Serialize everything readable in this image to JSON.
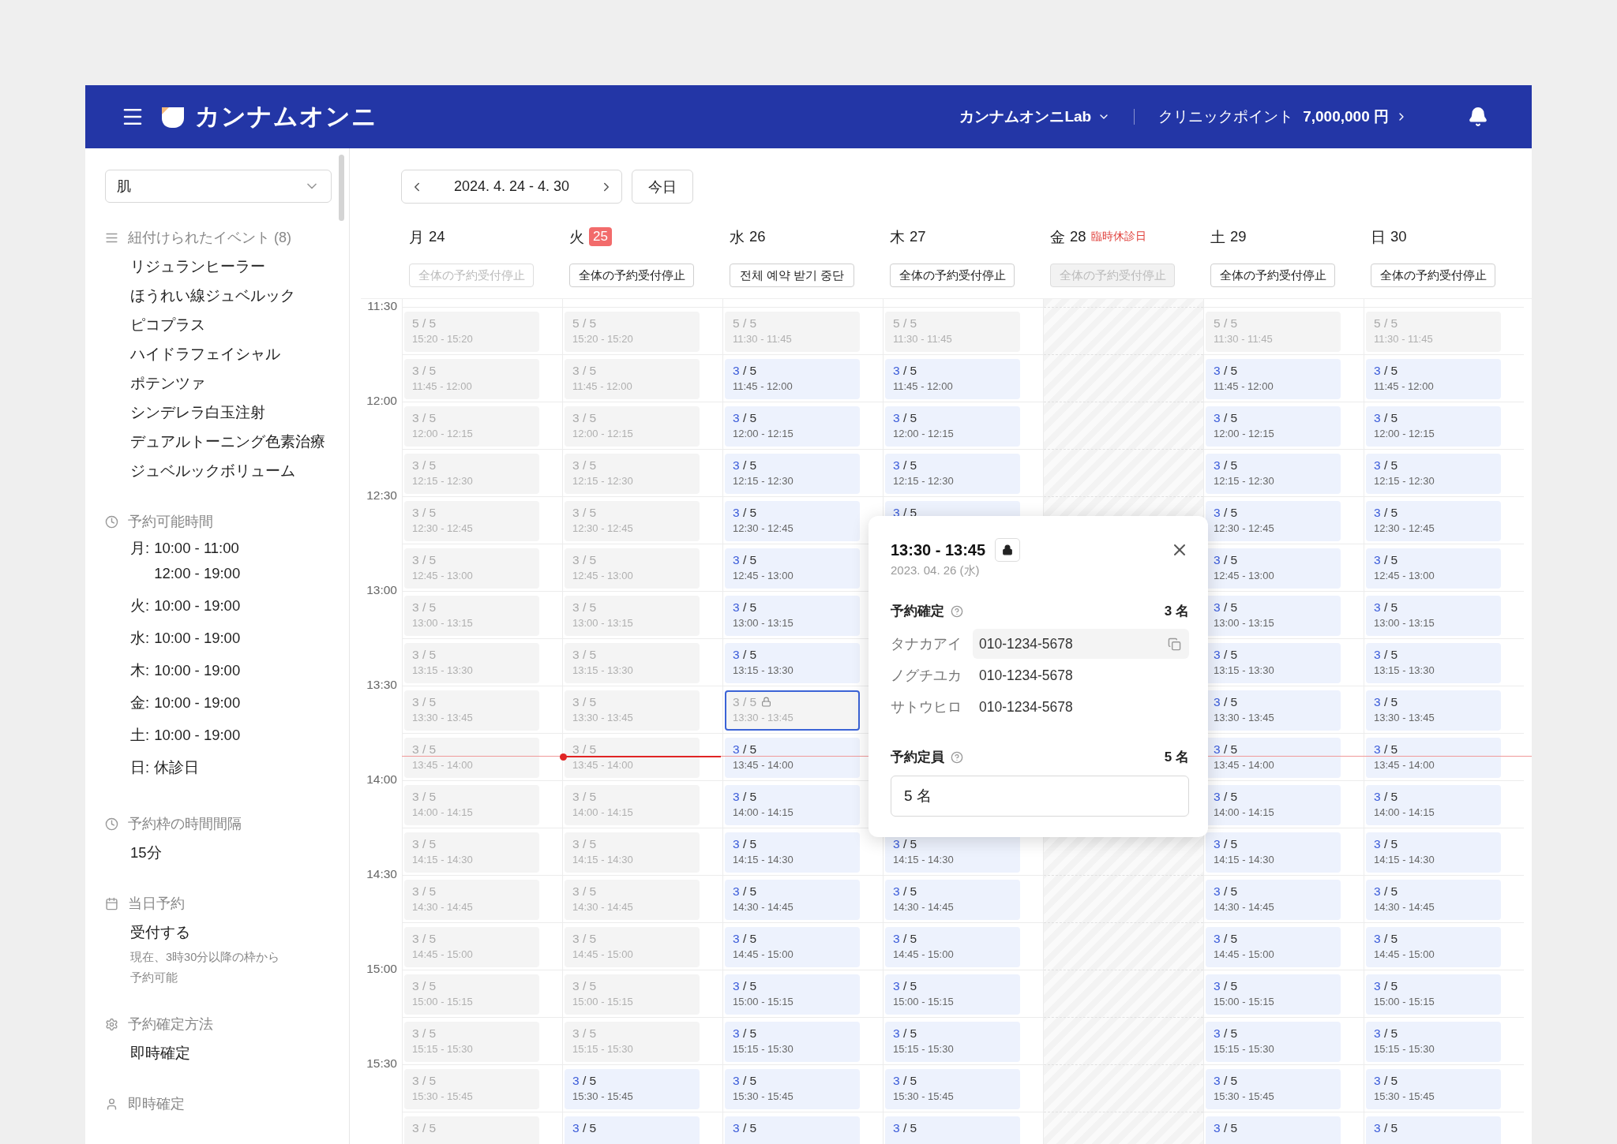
{
  "header": {
    "logo": "カンナムオンニ",
    "clinic": "カンナムオンニLab",
    "points_label": "クリニックポイント",
    "points_value": "7,000,000 円"
  },
  "sidebar": {
    "filter": {
      "value": "肌"
    },
    "sections": [
      {
        "kind": "list",
        "title": "紐付けられたイベント (8)",
        "items": [
          "リジュランヒーラー",
          "ほうれい線ジュベルック",
          "ピコプラス",
          "ハイドラフェイシャル",
          "ポテンツァ",
          "シンデレラ白玉注射",
          "デュアルトーニング色素治療",
          "ジュベルックボリューム"
        ]
      },
      {
        "kind": "hours",
        "title": "予約可能時間",
        "hours": [
          {
            "day": "月:",
            "ranges": [
              "10:00 - 11:00",
              "12:00 - 19:00"
            ]
          },
          {
            "day": "火:",
            "ranges": [
              "10:00 - 19:00"
            ]
          },
          {
            "day": "水:",
            "ranges": [
              "10:00 - 19:00"
            ]
          },
          {
            "day": "木:",
            "ranges": [
              "10:00 - 19:00"
            ]
          },
          {
            "day": "金:",
            "ranges": [
              "10:00 - 19:00"
            ]
          },
          {
            "day": "土:",
            "ranges": [
              "10:00 - 19:00"
            ]
          },
          {
            "day": "日:",
            "ranges": [
              "休診日"
            ]
          }
        ]
      },
      {
        "kind": "text",
        "title": "予約枠の時間間隔",
        "value": "15分"
      },
      {
        "kind": "text",
        "title": "当日予約",
        "value": "受付する",
        "note": "現在、3時30分以降の枠から予約可能"
      },
      {
        "kind": "text",
        "title": "予約確定方法",
        "value": "即時確定"
      },
      {
        "kind": "heading",
        "title": "即時確定"
      }
    ]
  },
  "toolbar": {
    "range": "2024. 4. 24 - 4. 30",
    "today_button": "今日"
  },
  "times": [
    "11:30",
    "12:00",
    "12:30",
    "13:00",
    "13:30",
    "14:00",
    "14:30",
    "15:00",
    "15:30"
  ],
  "days": [
    {
      "weekday": "月",
      "date": "24",
      "today": false,
      "closed": false,
      "stop": {
        "label": "全体の予約受付停止",
        "disabled": true
      },
      "slots": [
        {
          "booked": "5",
          "total": "/ 5",
          "time": "15:20 - 15:20",
          "available": false,
          "selected": false,
          "locked": false
        },
        {
          "booked": "3",
          "total": "/ 5",
          "time": "11:45 - 12:00",
          "available": false,
          "selected": false,
          "locked": false
        },
        {
          "booked": "3",
          "total": "/ 5",
          "time": "12:00 - 12:15",
          "available": false,
          "selected": false,
          "locked": false
        },
        {
          "booked": "3",
          "total": "/ 5",
          "time": "12:15 - 12:30",
          "available": false,
          "selected": false,
          "locked": false
        },
        {
          "booked": "3",
          "total": "/ 5",
          "time": "12:30 - 12:45",
          "available": false,
          "selected": false,
          "locked": false
        },
        {
          "booked": "3",
          "total": "/ 5",
          "time": "12:45 - 13:00",
          "available": false,
          "selected": false,
          "locked": false
        },
        {
          "booked": "3",
          "total": "/ 5",
          "time": "13:00 - 13:15",
          "available": false,
          "selected": false,
          "locked": false
        },
        {
          "booked": "3",
          "total": "/ 5",
          "time": "13:15 - 13:30",
          "available": false,
          "selected": false,
          "locked": false
        },
        {
          "booked": "3",
          "total": "/ 5",
          "time": "13:30 - 13:45",
          "available": false,
          "selected": false,
          "locked": false
        },
        {
          "booked": "3",
          "total": "/ 5",
          "time": "13:45 - 14:00",
          "available": false,
          "selected": false,
          "locked": false
        },
        {
          "booked": "3",
          "total": "/ 5",
          "time": "14:00 - 14:15",
          "available": false,
          "selected": false,
          "locked": false
        },
        {
          "booked": "3",
          "total": "/ 5",
          "time": "14:15 - 14:30",
          "available": false,
          "selected": false,
          "locked": false
        },
        {
          "booked": "3",
          "total": "/ 5",
          "time": "14:30 - 14:45",
          "available": false,
          "selected": false,
          "locked": false
        },
        {
          "booked": "3",
          "total": "/ 5",
          "time": "14:45 - 15:00",
          "available": false,
          "selected": false,
          "locked": false
        },
        {
          "booked": "3",
          "total": "/ 5",
          "time": "15:00 - 15:15",
          "available": false,
          "selected": false,
          "locked": false
        },
        {
          "booked": "3",
          "total": "/ 5",
          "time": "15:15 - 15:30",
          "available": false,
          "selected": false,
          "locked": false
        },
        {
          "booked": "3",
          "total": "/ 5",
          "time": "15:30 - 15:45",
          "available": false,
          "selected": false,
          "locked": false
        },
        {
          "booked": "3",
          "total": "/ 5",
          "available": false,
          "selected": false,
          "locked": false
        }
      ]
    },
    {
      "weekday": "火",
      "date": "25",
      "today": true,
      "closed": false,
      "stop": {
        "label": "全体の予約受付停止",
        "disabled": false
      },
      "slots": [
        {
          "booked": "5",
          "total": "/ 5",
          "time": "15:20 - 15:20",
          "available": false,
          "selected": false,
          "locked": false
        },
        {
          "booked": "3",
          "total": "/ 5",
          "time": "11:45 - 12:00",
          "available": false,
          "selected": false,
          "locked": false
        },
        {
          "booked": "3",
          "total": "/ 5",
          "time": "12:00 - 12:15",
          "available": false,
          "selected": false,
          "locked": false
        },
        {
          "booked": "3",
          "total": "/ 5",
          "time": "12:15 - 12:30",
          "available": false,
          "selected": false,
          "locked": false
        },
        {
          "booked": "3",
          "total": "/ 5",
          "time": "12:30 - 12:45",
          "available": false,
          "selected": false,
          "locked": false
        },
        {
          "booked": "3",
          "total": "/ 5",
          "time": "12:45 - 13:00",
          "available": false,
          "selected": false,
          "locked": false
        },
        {
          "booked": "3",
          "total": "/ 5",
          "time": "13:00 - 13:15",
          "available": false,
          "selected": false,
          "locked": false
        },
        {
          "booked": "3",
          "total": "/ 5",
          "time": "13:15 - 13:30",
          "available": false,
          "selected": false,
          "locked": false
        },
        {
          "booked": "3",
          "total": "/ 5",
          "time": "13:30 - 13:45",
          "available": false,
          "selected": false,
          "locked": false
        },
        {
          "booked": "3",
          "total": "/ 5",
          "time": "13:45 - 14:00",
          "available": false,
          "selected": false,
          "locked": false
        },
        {
          "booked": "3",
          "total": "/ 5",
          "time": "14:00 - 14:15",
          "available": false,
          "selected": false,
          "locked": false
        },
        {
          "booked": "3",
          "total": "/ 5",
          "time": "14:15 - 14:30",
          "available": false,
          "selected": false,
          "locked": false
        },
        {
          "booked": "3",
          "total": "/ 5",
          "time": "14:30 - 14:45",
          "available": false,
          "selected": false,
          "locked": false
        },
        {
          "booked": "3",
          "total": "/ 5",
          "time": "14:45 - 15:00",
          "available": false,
          "selected": false,
          "locked": false
        },
        {
          "booked": "3",
          "total": "/ 5",
          "time": "15:00 - 15:15",
          "available": false,
          "selected": false,
          "locked": false
        },
        {
          "booked": "3",
          "total": "/ 5",
          "time": "15:15 - 15:30",
          "available": false,
          "selected": false,
          "locked": false
        },
        {
          "booked": "3",
          "total": "/ 5",
          "time": "15:30 - 15:45",
          "available": true,
          "selected": false,
          "locked": false
        },
        {
          "booked": "3",
          "total": "/ 5",
          "available": true,
          "selected": false,
          "locked": false
        }
      ]
    },
    {
      "weekday": "水",
      "date": "26",
      "today": false,
      "closed": false,
      "stop": {
        "label": "전체 예약 받기 중단",
        "disabled": false
      },
      "slots": [
        {
          "booked": "5",
          "total": "/ 5",
          "time": "11:30 - 11:45",
          "available": false,
          "selected": false,
          "locked": false
        },
        {
          "booked": "3",
          "total": "/ 5",
          "time": "11:45 - 12:00",
          "available": true,
          "selected": false,
          "locked": false
        },
        {
          "booked": "3",
          "total": "/ 5",
          "time": "12:00 - 12:15",
          "available": true,
          "selected": false,
          "locked": false
        },
        {
          "booked": "3",
          "total": "/ 5",
          "time": "12:15 - 12:30",
          "available": true,
          "selected": false,
          "locked": false
        },
        {
          "booked": "3",
          "total": "/ 5",
          "time": "12:30 - 12:45",
          "available": true,
          "selected": false,
          "locked": false
        },
        {
          "booked": "3",
          "total": "/ 5",
          "time": "12:45 - 13:00",
          "available": true,
          "selected": false,
          "locked": false
        },
        {
          "booked": "3",
          "total": "/ 5",
          "time": "13:00 - 13:15",
          "available": true,
          "selected": false,
          "locked": false
        },
        {
          "booked": "3",
          "total": "/ 5",
          "time": "13:15 - 13:30",
          "available": true,
          "selected": false,
          "locked": false
        },
        {
          "booked": "3",
          "total": "/ 5",
          "time": "13:30 - 13:45",
          "available": false,
          "selected": true,
          "locked": true
        },
        {
          "booked": "3",
          "total": "/ 5",
          "time": "13:45 - 14:00",
          "available": true,
          "selected": false,
          "locked": false
        },
        {
          "booked": "3",
          "total": "/ 5",
          "time": "14:00 - 14:15",
          "available": true,
          "selected": false,
          "locked": false
        },
        {
          "booked": "3",
          "total": "/ 5",
          "time": "14:15 - 14:30",
          "available": true,
          "selected": false,
          "locked": false
        },
        {
          "booked": "3",
          "total": "/ 5",
          "time": "14:30 - 14:45",
          "available": true,
          "selected": false,
          "locked": false
        },
        {
          "booked": "3",
          "total": "/ 5",
          "time": "14:45 - 15:00",
          "available": true,
          "selected": false,
          "locked": false
        },
        {
          "booked": "3",
          "total": "/ 5",
          "time": "15:00 - 15:15",
          "available": true,
          "selected": false,
          "locked": false
        },
        {
          "booked": "3",
          "total": "/ 5",
          "time": "15:15 - 15:30",
          "available": true,
          "selected": false,
          "locked": false
        },
        {
          "booked": "3",
          "total": "/ 5",
          "time": "15:30 - 15:45",
          "available": true,
          "selected": false,
          "locked": false
        },
        {
          "booked": "3",
          "total": "/ 5",
          "available": true,
          "selected": false,
          "locked": false
        }
      ]
    },
    {
      "weekday": "木",
      "date": "27",
      "today": false,
      "closed": false,
      "stop": {
        "label": "全体の予約受付停止",
        "disabled": false
      },
      "slots": [
        {
          "booked": "5",
          "total": "/ 5",
          "time": "11:30 - 11:45",
          "available": false,
          "selected": false,
          "locked": false
        },
        {
          "booked": "3",
          "total": "/ 5",
          "time": "11:45 - 12:00",
          "available": true,
          "selected": false,
          "locked": false
        },
        {
          "booked": "3",
          "total": "/ 5",
          "time": "12:00 - 12:15",
          "available": true,
          "selected": false,
          "locked": false
        },
        {
          "booked": "3",
          "total": "/ 5",
          "time": "12:15 - 12:30",
          "available": true,
          "selected": false,
          "locked": false
        },
        {
          "booked": "3",
          "total": "/ 5",
          "available": true,
          "selected": false,
          "locked": false
        }
      ],
      "slots_below": [
        {
          "booked": "3",
          "total": "/ 5",
          "time": "14:15 - 14:30",
          "available": true,
          "selected": false,
          "locked": false
        },
        {
          "booked": "3",
          "total": "/ 5",
          "time": "14:30 - 14:45",
          "available": true,
          "selected": false,
          "locked": false
        },
        {
          "booked": "3",
          "total": "/ 5",
          "time": "14:45 - 15:00",
          "available": true,
          "selected": false,
          "locked": false
        },
        {
          "booked": "3",
          "total": "/ 5",
          "time": "15:00 - 15:15",
          "available": true,
          "selected": false,
          "locked": false
        },
        {
          "booked": "3",
          "total": "/ 5",
          "time": "15:15 - 15:30",
          "available": true,
          "selected": false,
          "locked": false
        },
        {
          "booked": "3",
          "total": "/ 5",
          "time": "15:30 - 15:45",
          "available": true,
          "selected": false,
          "locked": false
        },
        {
          "booked": "3",
          "total": "/ 5",
          "available": true,
          "selected": false,
          "locked": false
        }
      ]
    },
    {
      "weekday": "金",
      "date": "28",
      "today": false,
      "closed": true,
      "closed_note": "臨時休診日",
      "stop": {
        "label": "全体の予約受付停止",
        "disabled": true
      }
    },
    {
      "weekday": "土",
      "date": "29",
      "today": false,
      "closed": false,
      "stop": {
        "label": "全体の予約受付停止",
        "disabled": false
      },
      "slots": [
        {
          "booked": "5",
          "total": "/ 5",
          "time": "11:30 - 11:45",
          "available": false,
          "selected": false,
          "locked": false
        },
        {
          "booked": "3",
          "total": "/ 5",
          "time": "11:45 - 12:00",
          "available": true,
          "selected": false,
          "locked": false
        },
        {
          "booked": "3",
          "total": "/ 5",
          "time": "12:00 - 12:15",
          "available": true,
          "selected": false,
          "locked": false
        },
        {
          "booked": "3",
          "total": "/ 5",
          "time": "12:15 - 12:30",
          "available": true,
          "selected": false,
          "locked": false
        },
        {
          "booked": "3",
          "total": "/ 5",
          "time": "12:30 - 12:45",
          "available": true,
          "selected": false,
          "locked": false
        },
        {
          "booked": "3",
          "total": "/ 5",
          "time": "12:45 - 13:00",
          "available": true,
          "selected": false,
          "locked": false
        },
        {
          "booked": "3",
          "total": "/ 5",
          "time": "13:00 - 13:15",
          "available": true,
          "selected": false,
          "locked": false
        },
        {
          "booked": "3",
          "total": "/ 5",
          "time": "13:15 - 13:30",
          "available": true,
          "selected": false,
          "locked": false
        },
        {
          "booked": "3",
          "total": "/ 5",
          "time": "13:30 - 13:45",
          "available": true,
          "selected": false,
          "locked": false
        },
        {
          "booked": "3",
          "total": "/ 5",
          "time": "13:45 - 14:00",
          "available": true,
          "selected": false,
          "locked": false
        },
        {
          "booked": "3",
          "total": "/ 5",
          "time": "14:00 - 14:15",
          "available": true,
          "selected": false,
          "locked": false
        },
        {
          "booked": "3",
          "total": "/ 5",
          "time": "14:15 - 14:30",
          "available": true,
          "selected": false,
          "locked": false
        },
        {
          "booked": "3",
          "total": "/ 5",
          "time": "14:30 - 14:45",
          "available": true,
          "selected": false,
          "locked": false
        },
        {
          "booked": "3",
          "total": "/ 5",
          "time": "14:45 - 15:00",
          "available": true,
          "selected": false,
          "locked": false
        },
        {
          "booked": "3",
          "total": "/ 5",
          "time": "15:00 - 15:15",
          "available": true,
          "selected": false,
          "locked": false
        },
        {
          "booked": "3",
          "total": "/ 5",
          "time": "15:15 - 15:30",
          "available": true,
          "selected": false,
          "locked": false
        },
        {
          "booked": "3",
          "total": "/ 5",
          "time": "15:30 - 15:45",
          "available": true,
          "selected": false,
          "locked": false
        },
        {
          "booked": "3",
          "total": "/ 5",
          "available": true,
          "selected": false,
          "locked": false
        }
      ]
    },
    {
      "weekday": "日",
      "date": "30",
      "today": false,
      "closed": false,
      "stop": {
        "label": "全体の予約受付停止",
        "disabled": false
      },
      "slots": [
        {
          "booked": "5",
          "total": "/ 5",
          "time": "11:30 - 11:45",
          "available": false,
          "selected": false,
          "locked": false
        },
        {
          "booked": "3",
          "total": "/ 5",
          "time": "11:45 - 12:00",
          "available": true,
          "selected": false,
          "locked": false
        },
        {
          "booked": "3",
          "total": "/ 5",
          "time": "12:00 - 12:15",
          "available": true,
          "selected": false,
          "locked": false
        },
        {
          "booked": "3",
          "total": "/ 5",
          "time": "12:15 - 12:30",
          "available": true,
          "selected": false,
          "locked": false
        },
        {
          "booked": "3",
          "total": "/ 5",
          "time": "12:30 - 12:45",
          "available": true,
          "selected": false,
          "locked": false
        },
        {
          "booked": "3",
          "total": "/ 5",
          "time": "12:45 - 13:00",
          "available": true,
          "selected": false,
          "locked": false
        },
        {
          "booked": "3",
          "total": "/ 5",
          "time": "13:00 - 13:15",
          "available": true,
          "selected": false,
          "locked": false
        },
        {
          "booked": "3",
          "total": "/ 5",
          "time": "13:15 - 13:30",
          "available": true,
          "selected": false,
          "locked": false
        },
        {
          "booked": "3",
          "total": "/ 5",
          "time": "13:30 - 13:45",
          "available": true,
          "selected": false,
          "locked": false
        },
        {
          "booked": "3",
          "total": "/ 5",
          "time": "13:45 - 14:00",
          "available": true,
          "selected": false,
          "locked": false
        },
        {
          "booked": "3",
          "total": "/ 5",
          "time": "14:00 - 14:15",
          "available": true,
          "selected": false,
          "locked": false
        },
        {
          "booked": "3",
          "total": "/ 5",
          "time": "14:15 - 14:30",
          "available": true,
          "selected": false,
          "locked": false
        },
        {
          "booked": "3",
          "total": "/ 5",
          "time": "14:30 - 14:45",
          "available": true,
          "selected": false,
          "locked": false
        },
        {
          "booked": "3",
          "total": "/ 5",
          "time": "14:45 - 15:00",
          "available": true,
          "selected": false,
          "locked": false
        },
        {
          "booked": "3",
          "total": "/ 5",
          "time": "15:00 - 15:15",
          "available": true,
          "selected": false,
          "locked": false
        },
        {
          "booked": "3",
          "total": "/ 5",
          "time": "15:15 - 15:30",
          "available": true,
          "selected": false,
          "locked": false
        },
        {
          "booked": "3",
          "total": "/ 5",
          "time": "15:30 - 15:45",
          "available": true,
          "selected": false,
          "locked": false
        },
        {
          "booked": "3",
          "total": "/ 5",
          "available": true,
          "selected": false,
          "locked": false
        }
      ]
    }
  ],
  "popup": {
    "time": "13:30 - 13:45",
    "date": "2023. 04. 26 (水)",
    "confirmed_label": "予約確定",
    "confirmed_count": "3 名",
    "people": [
      {
        "name": "タナカアイ",
        "phone": "010-1234-5678",
        "hovered": true
      },
      {
        "name": "ノグチユカ",
        "phone": "010-1234-5678",
        "hovered": false
      },
      {
        "name": "サトウヒロ",
        "phone": "010-1234-5678",
        "hovered": false
      }
    ],
    "capacity_label": "予約定員",
    "capacity_count": "5 名",
    "capacity_value": "5 名"
  }
}
